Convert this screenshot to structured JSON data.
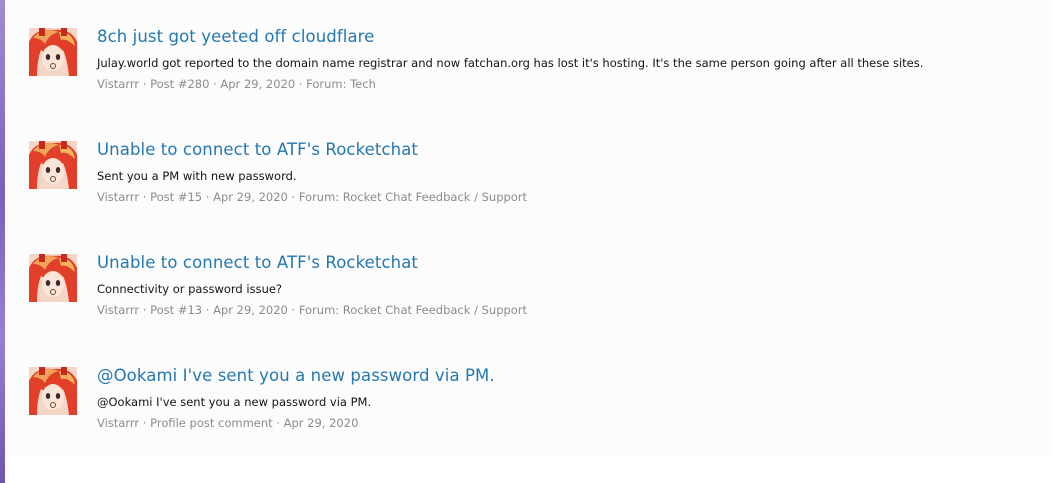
{
  "results": [
    {
      "title": "8ch just got yeeted off cloudflare",
      "snippet": "Julay.world got reported to the domain name registrar and now fatchan.org has lost it's hosting. It's the same person going after all these sites.",
      "author": "Vistarrr",
      "post_ref": "Post #280",
      "date": "Apr 29, 2020",
      "forum": "Forum: Tech"
    },
    {
      "title": "Unable to connect to ATF's Rocketchat",
      "snippet": "Sent you a PM with new password.",
      "author": "Vistarrr",
      "post_ref": "Post #15",
      "date": "Apr 29, 2020",
      "forum": "Forum: Rocket Chat Feedback / Support"
    },
    {
      "title": "Unable to connect to ATF's Rocketchat",
      "snippet": "Connectivity or password issue?",
      "author": "Vistarrr",
      "post_ref": "Post #13",
      "date": "Apr 29, 2020",
      "forum": "Forum: Rocket Chat Feedback / Support"
    },
    {
      "title": "@Ookami I've sent you a new password via PM.",
      "snippet": "@Ookami I've sent you a new password via PM.",
      "author": "Vistarrr",
      "post_ref": "Profile post comment",
      "date": "Apr 29, 2020"
    }
  ],
  "separator": " · ",
  "colors": {
    "title_link": "#2577b1",
    "meta_text": "#8c8c8c",
    "snippet_text": "#141414"
  },
  "icons": {
    "avatar": "anime-girl-avatar-icon"
  }
}
